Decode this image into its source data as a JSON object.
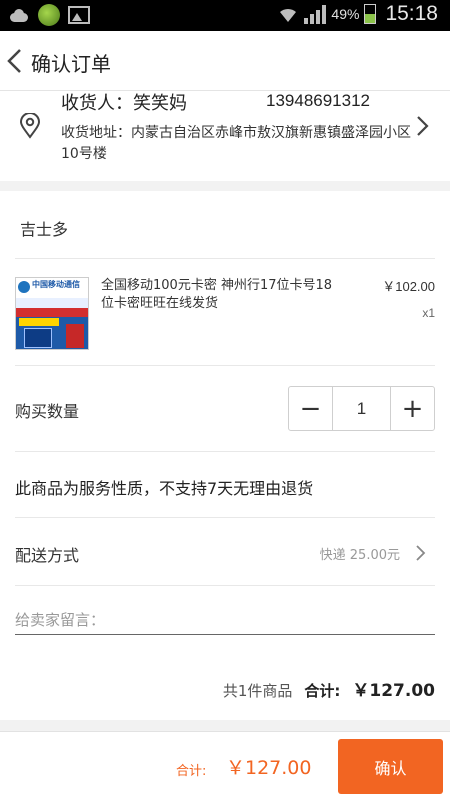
{
  "status_bar": {
    "battery": "49%",
    "time": "15:18",
    "battery_level": 0.49
  },
  "header": {
    "title": "确认订单"
  },
  "address": {
    "receiver": "收货人：笑笑妈",
    "phone": "13948691312",
    "detail": "收货地址：内蒙古自治区赤峰市敖汉旗新惠镇盛泽园小区10号楼"
  },
  "shop": {
    "name": "吉士多"
  },
  "product": {
    "title": "全国移动100元卡密 神州行17位卡号18位卡密旺旺在线发货",
    "price": "￥102.00",
    "qty": "x1",
    "image_brand": "中国移动通信"
  },
  "quantity": {
    "label": "购买数量",
    "value": "1",
    "minus": "−",
    "plus": "+"
  },
  "notice": "此商品为服务性质，不支持7天无理由退货",
  "shipping": {
    "label": "配送方式",
    "value": "快递 25.00元"
  },
  "message": {
    "placeholder": "给卖家留言："
  },
  "summary": {
    "count": "共1件商品",
    "label": "合计:",
    "amount": "￥127.00"
  },
  "bottom": {
    "label": "合计:",
    "total": "￥127.00",
    "confirm": "确认"
  },
  "colors": {
    "accent": "#f26522",
    "separator": "#f2f2f2"
  }
}
